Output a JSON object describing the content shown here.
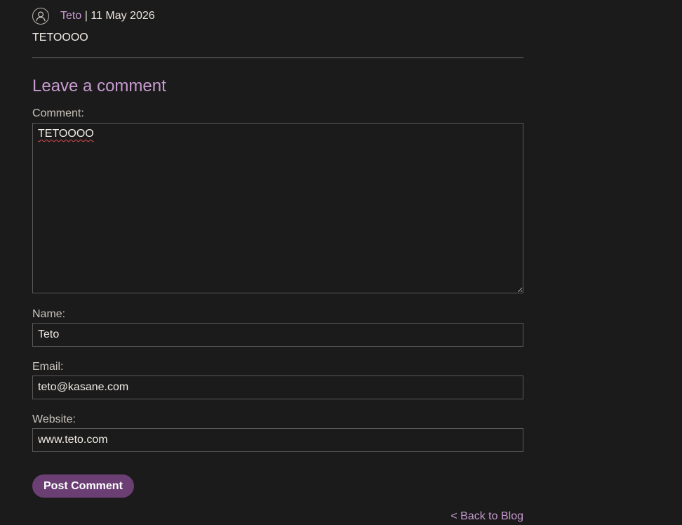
{
  "comment": {
    "author": "Teto",
    "separator": "|",
    "date": "11 May 2026",
    "body": "TETOOOO",
    "avatar_icon": "user-avatar-icon"
  },
  "form": {
    "title": "Leave a comment",
    "comment_label": "Comment:",
    "comment_value": "TETOOOO",
    "name_label": "Name:",
    "name_value": "Teto",
    "email_label": "Email:",
    "email_value": "teto@kasane.com",
    "website_label": "Website:",
    "website_value": "www.teto.com",
    "submit_label": "Post Comment"
  },
  "footer": {
    "back_link": "< Back to Blog"
  },
  "colors": {
    "background": "#1c1b1c",
    "accent": "#c79bd0",
    "button": "#6b3f74",
    "text": "#e8e4dc"
  }
}
